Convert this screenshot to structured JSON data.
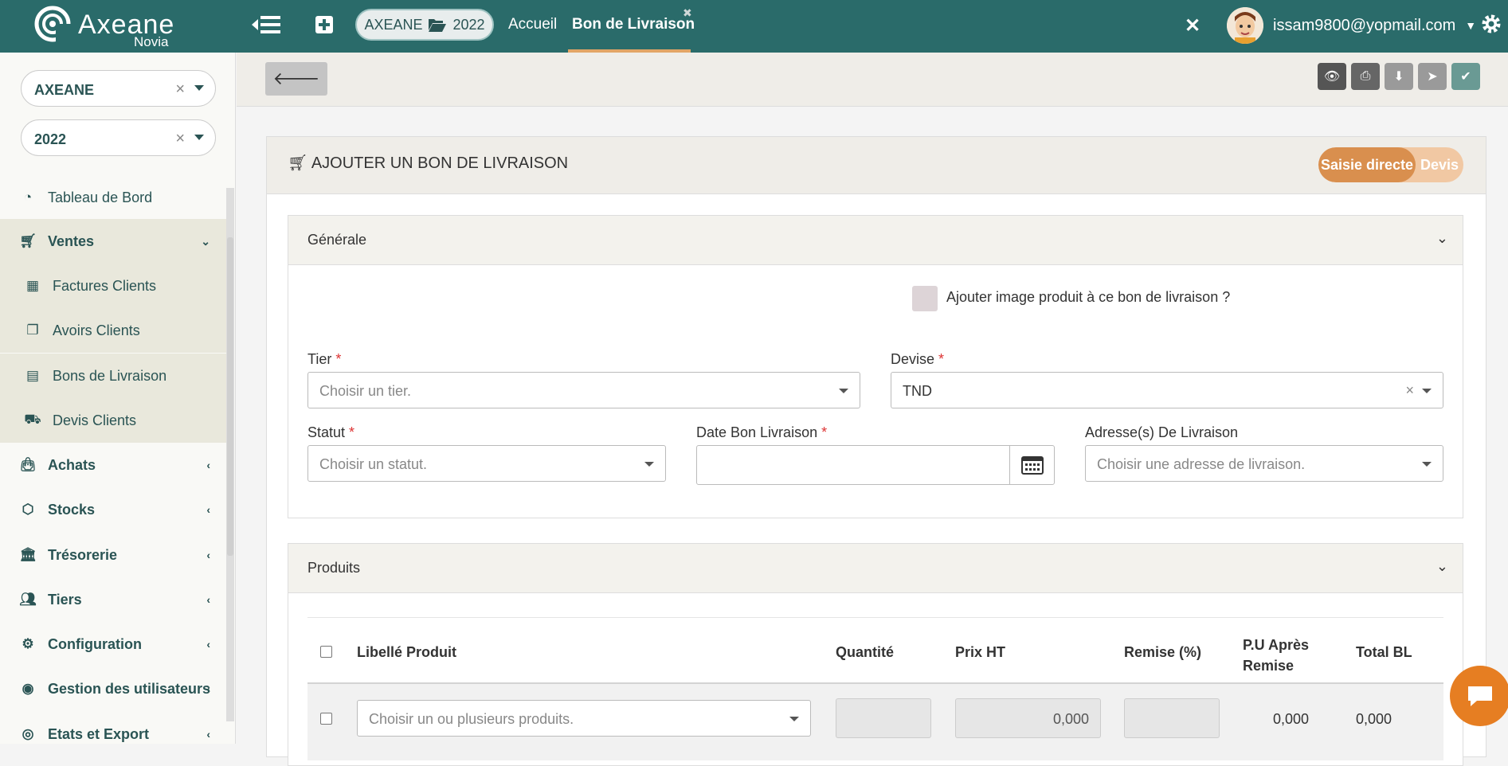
{
  "header": {
    "logo_text": "Axeane",
    "logo_sub": "Novia",
    "context_pill": {
      "company": "AXEANE",
      "year": "2022"
    },
    "nav": {
      "home": "Accueil",
      "active": "Bon de Livraison"
    },
    "user_email": "issam9800@yopmail.com",
    "icons": [
      "menu-icon",
      "plus-square-icon",
      "folder-open-icon",
      "close-icon",
      "caret-down-icon",
      "gear-icon"
    ]
  },
  "sidebar": {
    "company_select": "AXEANE",
    "year_select": "2022",
    "items": [
      {
        "label": "Tableau de Bord",
        "icon": "dashboard-icon"
      },
      {
        "label": "Ventes",
        "icon": "cart-icon"
      },
      {
        "label": "Factures Clients",
        "icon": "calculator-icon"
      },
      {
        "label": "Avoirs Clients",
        "icon": "copy-icon"
      },
      {
        "label": "Bons de Livraison",
        "icon": "file-icon"
      },
      {
        "label": "Devis Clients",
        "icon": "cart-plus-icon"
      },
      {
        "label": "Achats",
        "icon": "bag-icon"
      },
      {
        "label": "Stocks",
        "icon": "cube-icon"
      },
      {
        "label": "Trésorerie",
        "icon": "bank-icon"
      },
      {
        "label": "Tiers",
        "icon": "users-icon"
      },
      {
        "label": "Configuration",
        "icon": "gear-icon"
      },
      {
        "label": "Gestion des utilisateurs",
        "icon": "user-circle-icon"
      },
      {
        "label": "Etats et Export",
        "icon": "podcast-icon"
      }
    ]
  },
  "toolbar": {
    "action_icons": [
      "eye-icon",
      "print-icon",
      "download-icon",
      "send-icon",
      "check-icon"
    ]
  },
  "form": {
    "title": "AJOUTER UN BON DE LIVRAISON",
    "toggle": {
      "on": "Saisie directe",
      "off": "Devis"
    },
    "general": {
      "header": "Générale",
      "image_checkbox_label": "Ajouter image produit à ce bon de livraison ?",
      "tier": {
        "label": "Tier",
        "placeholder": "Choisir un tier."
      },
      "devise": {
        "label": "Devise",
        "value": "TND"
      },
      "statut": {
        "label": "Statut",
        "placeholder": "Choisir un statut."
      },
      "date": {
        "label": "Date Bon Livraison",
        "value": ""
      },
      "adresse": {
        "label": "Adresse(s) De Livraison",
        "placeholder": "Choisir une adresse de livraison."
      }
    },
    "produits": {
      "header": "Produits",
      "columns": [
        "Libellé Produit",
        "Quantité",
        "Prix HT",
        "Remise (%)",
        "P.U Après Remise",
        "Total BL"
      ],
      "row": {
        "product_placeholder": "Choisir un ou plusieurs produits.",
        "prix_ht": "0,000",
        "pu_apres_remise": "0,000",
        "total_bl": "0,000"
      }
    }
  }
}
